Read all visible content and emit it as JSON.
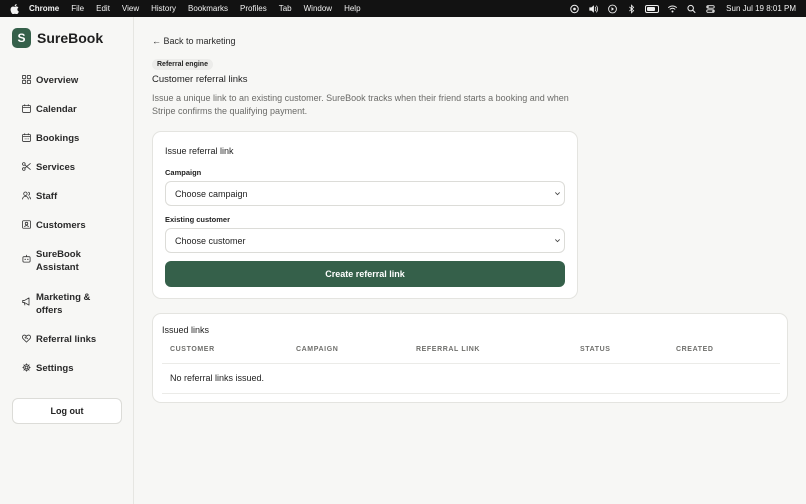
{
  "menubar": {
    "app": "Chrome",
    "items": [
      "File",
      "Edit",
      "View",
      "History",
      "Bookmarks",
      "Profiles",
      "Tab",
      "Window",
      "Help"
    ],
    "clock": "Sun Jul 19  8:01 PM"
  },
  "sidebar": {
    "logo_letter": "S",
    "brand": "SureBook",
    "items": [
      {
        "label": "Overview",
        "icon": "grid-icon"
      },
      {
        "label": "Calendar",
        "icon": "calendar-icon"
      },
      {
        "label": "Bookings",
        "icon": "calendar-check-icon"
      },
      {
        "label": "Services",
        "icon": "scissors-icon"
      },
      {
        "label": "Staff",
        "icon": "users-icon"
      },
      {
        "label": "Customers",
        "icon": "contact-card-icon"
      },
      {
        "label": "SureBook Assistant",
        "icon": "bot-icon"
      },
      {
        "label": "Marketing & offers",
        "icon": "megaphone-icon"
      },
      {
        "label": "Referral links",
        "icon": "heart-handshake-icon"
      },
      {
        "label": "Settings",
        "icon": "gear-icon"
      }
    ],
    "logout": "Log out"
  },
  "main": {
    "back": "← Back to marketing",
    "badge": "Referral engine",
    "title": "Customer referral links",
    "description": "Issue a unique link to an existing customer. SureBook tracks when their friend starts a booking and when Stripe confirms the qualifying payment."
  },
  "issue_card": {
    "title": "Issue referral link",
    "campaign_label": "Campaign",
    "campaign_value": "Choose campaign",
    "customer_label": "Existing customer",
    "customer_value": "Choose customer",
    "submit": "Create referral link"
  },
  "issued_card": {
    "title": "Issued links",
    "columns": [
      "CUSTOMER",
      "CAMPAIGN",
      "REFERRAL LINK",
      "STATUS",
      "CREATED"
    ],
    "empty": "No referral links issued."
  },
  "colors": {
    "accent": "#35604a",
    "background": "#f7f7f5",
    "menubar": "#121212"
  }
}
